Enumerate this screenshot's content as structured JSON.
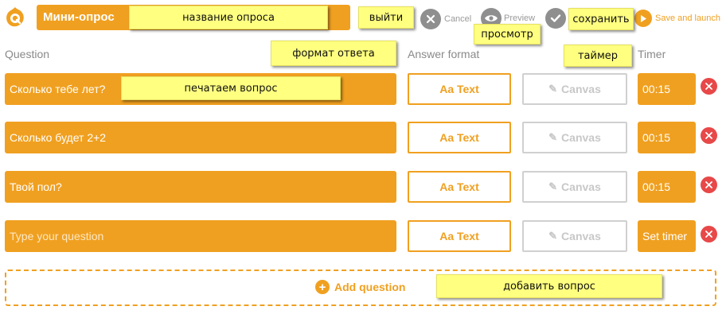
{
  "header": {
    "quiz_title": "Мини-опрос",
    "cancel_label": "Cancel",
    "preview_label": "Preview",
    "save_launch_label": "Save and launch"
  },
  "columns": {
    "question": "Question",
    "answer_format": "Answer format",
    "timer": "Timer"
  },
  "questions": [
    {
      "text": "Сколько тебе лет?",
      "format_text": "Aa Text",
      "format_canvas": "Canvas",
      "timer": "00:15"
    },
    {
      "text": "Сколько будет 2+2",
      "format_text": "Aa Text",
      "format_canvas": "Canvas",
      "timer": "00:15"
    },
    {
      "text": "Твой пол?",
      "format_text": "Aa Text",
      "format_canvas": "Canvas",
      "timer": "00:15"
    },
    {
      "text": "",
      "placeholder": "Type your question",
      "format_text": "Aa Text",
      "format_canvas": "Canvas",
      "timer": "Set timer"
    }
  ],
  "add_question_label": "Add question",
  "annotations": {
    "quiz_name": "название опроса",
    "exit": "выйти",
    "preview": "просмотр",
    "save": "сохранить",
    "answer_format": "формат ответа",
    "timer": "таймер",
    "type_question": "печатаем вопрос",
    "add_question": "добавить вопрос"
  },
  "colors": {
    "accent": "#f0a020",
    "delete": "#e84848",
    "icon_gray": "#8f8f8f",
    "note_yellow": "#ffff80"
  },
  "icons": {
    "logo": "quiz-logo-icon",
    "cancel": "close-circle-icon",
    "preview": "eye-icon",
    "save": "checkmark-circle-icon",
    "launch": "play-circle-icon",
    "canvas": "pen-icon",
    "delete": "close-circle-icon",
    "add": "plus-circle-icon"
  }
}
